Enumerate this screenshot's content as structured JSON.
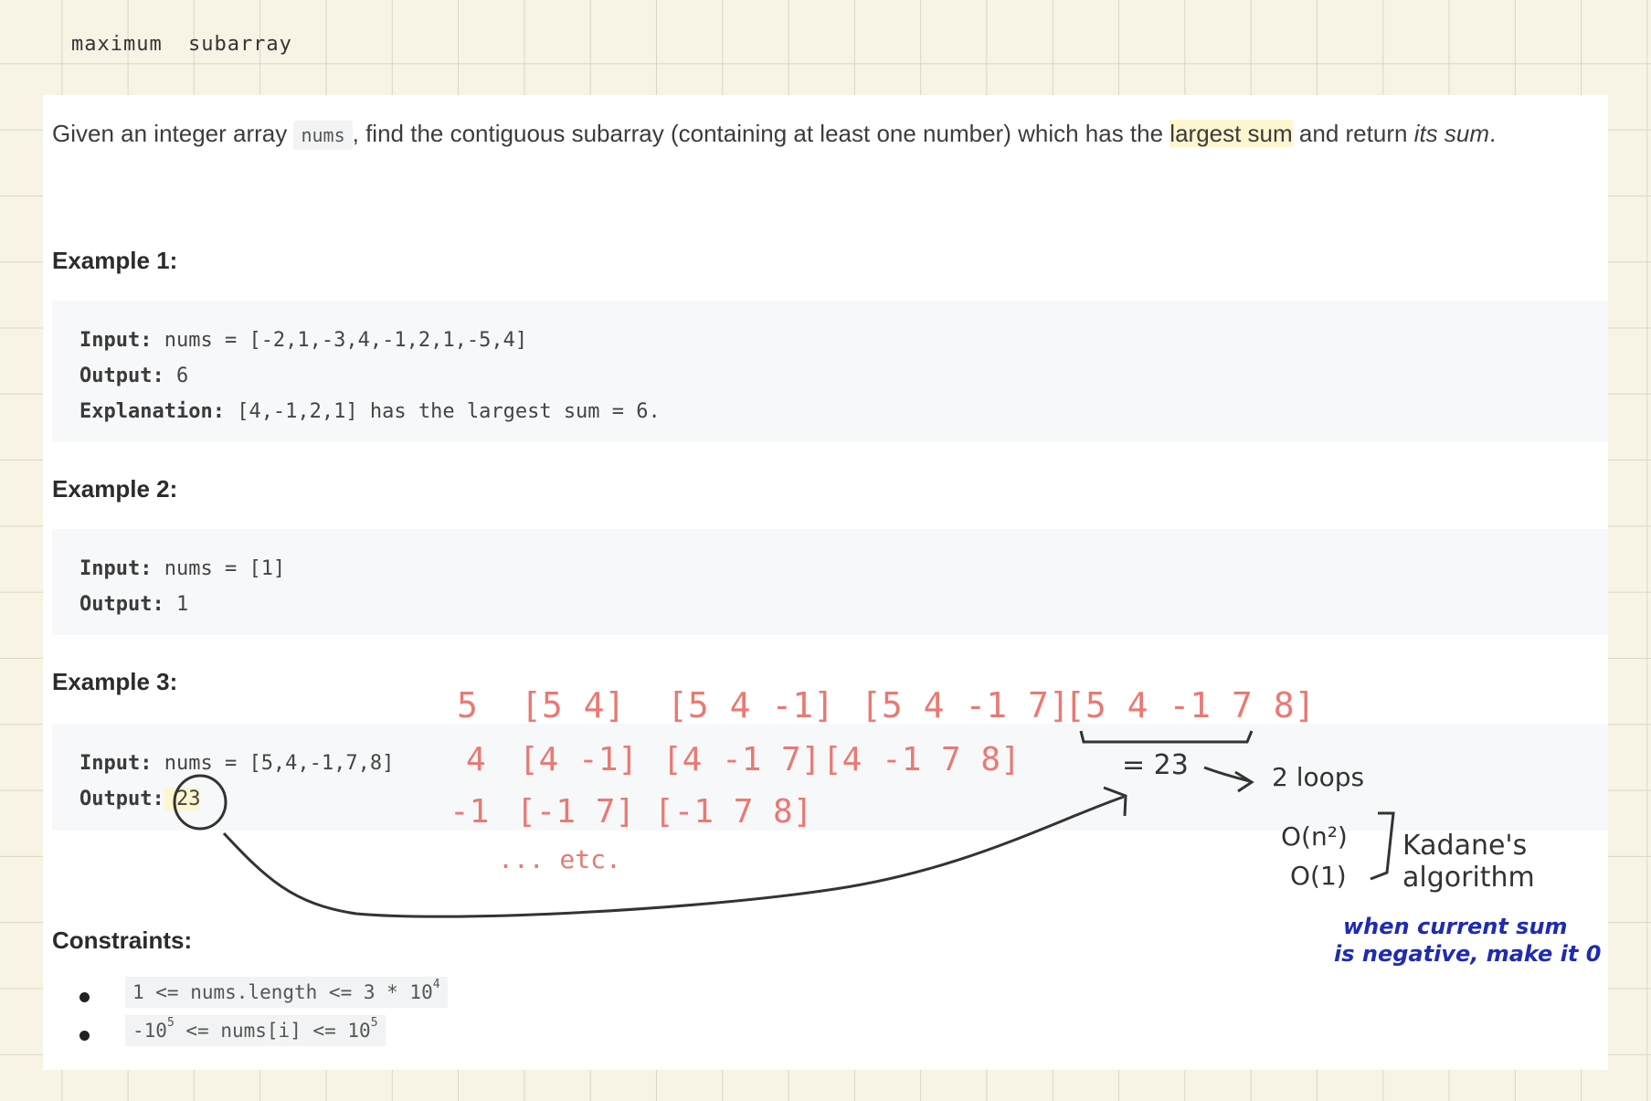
{
  "note": {
    "title": "maximum subarray"
  },
  "problem": {
    "desc_start": "Given an integer array ",
    "desc_code": "nums",
    "desc_mid1": ", find the contiguous ",
    "desc_hl1": "subarray",
    "desc_mid2": " (containing at least one number) which has the ",
    "desc_hl2": "largest sum",
    "desc_mid3": " and return ",
    "desc_em": "its sum",
    "desc_end": "."
  },
  "examples": [
    {
      "heading": "Example 1:",
      "lines": [
        {
          "key": "Input:",
          "value": " nums = [-2,1,-3,4,-1,2,1,-5,4]"
        },
        {
          "key": "Output:",
          "value": " 6"
        },
        {
          "key": "Explanation:",
          "value": " [4,-1,2,1] has the largest sum = 6."
        }
      ]
    },
    {
      "heading": "Example 2:",
      "lines": [
        {
          "key": "Input:",
          "value": " nums = [1]"
        },
        {
          "key": "Output:",
          "value": " 1"
        }
      ]
    },
    {
      "heading": "Example 3:",
      "lines": [
        {
          "key": "Input:",
          "value": " nums = [5,4,-1,7,8]"
        },
        {
          "key": "Output:",
          "value": " 23"
        }
      ]
    }
  ],
  "constraints": {
    "heading": "Constraints:",
    "items": [
      {
        "pre": "1 <= nums.length <= 3 * 10",
        "sup": "4",
        "post": ""
      },
      {
        "pre": "-10",
        "sup": "5",
        "post": " <= nums[i] <= 10",
        "sup2": "5"
      }
    ]
  },
  "annotations": {
    "row1": [
      "5",
      "[5 4]",
      "[5 4 -1]",
      "[5 4 -1 7]",
      "[5 4 -1 7 8]"
    ],
    "row2": [
      "4",
      "[4 -1]",
      "[4 -1 7]",
      "[4 -1 7 8]"
    ],
    "row3": [
      "-1",
      "[-1 7]",
      "[-1 7 8]"
    ],
    "etc": "... etc.",
    "sum": "= 23",
    "loops": "2 loops",
    "time": "O(n²)",
    "space": "O(1)",
    "kadane1": "Kadane's",
    "kadane2": "algorithm",
    "tip1": "when current sum",
    "tip2": "is negative, make it 0",
    "colors": {
      "red": "#e87a73",
      "blue": "#1f2bb0",
      "ink": "#333333"
    }
  }
}
